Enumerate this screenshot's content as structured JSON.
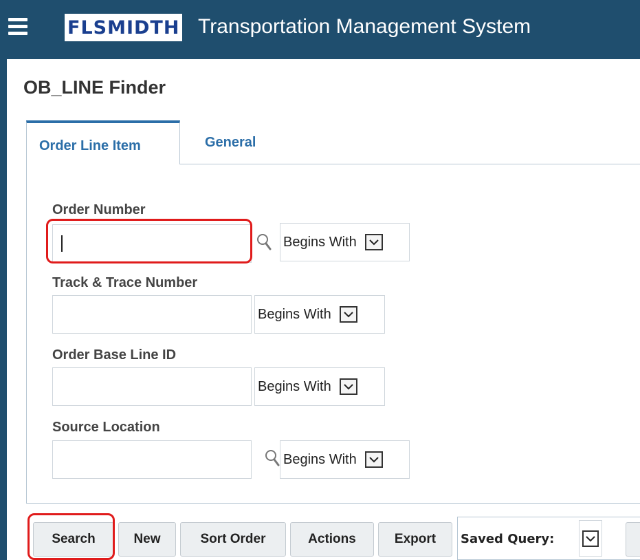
{
  "header": {
    "logo_text": "FLSMIDTH",
    "title": "Transportation Management System",
    "menu_icon": "hamburger-menu-icon",
    "background_color": "#1f4e6e"
  },
  "page": {
    "title": "OB_LINE Finder"
  },
  "tabs": [
    {
      "label": "Order Line Item",
      "active": true
    },
    {
      "label": "General",
      "active": false
    }
  ],
  "form": {
    "fields": [
      {
        "label": "Order Number",
        "value": "",
        "operator": "Begins With",
        "has_lookup": true,
        "focused": true
      },
      {
        "label": "Track & Trace Number",
        "value": "",
        "operator": "Begins With",
        "has_lookup": false
      },
      {
        "label": "Order Base Line ID",
        "value": "",
        "operator": "Begins With",
        "has_lookup": false
      },
      {
        "label": "Source Location",
        "value": "",
        "operator": "Begins With",
        "has_lookup": true
      }
    ]
  },
  "toolbar": {
    "search_label": "Search",
    "new_label": "New",
    "sort_order_label": "Sort Order",
    "actions_label": "Actions",
    "export_label": "Export",
    "saved_query_label": "Saved Query:"
  },
  "colors": {
    "accent": "#2b6ea8",
    "highlight": "#e01b1b"
  }
}
